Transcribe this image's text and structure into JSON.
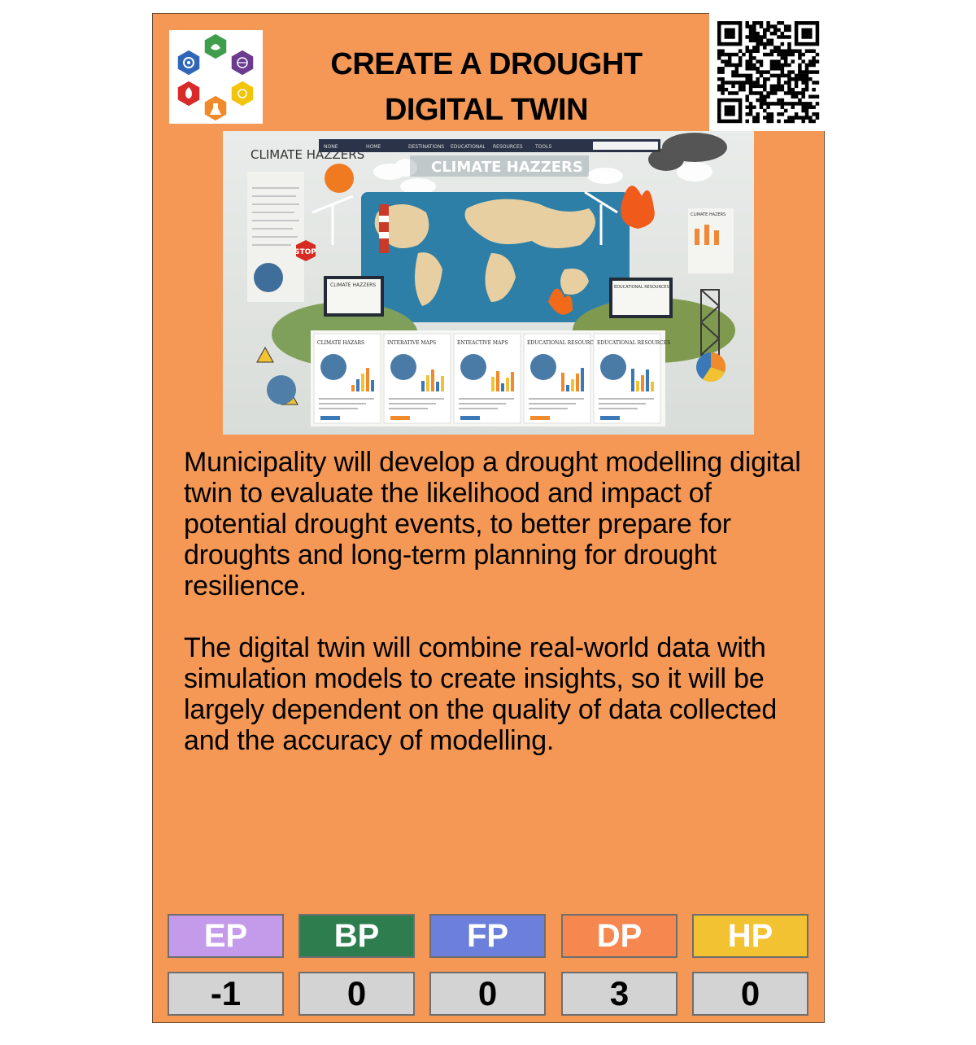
{
  "card": {
    "title_line1": "CREATE A DROUGHT",
    "title_line2": "DIGITAL TWIN",
    "paragraph1": "Municipality will develop a drought modelling digital twin to evaluate the likelihood and impact of potential drought events, to better prepare for droughts and long-term planning for drought resilience.",
    "paragraph2": "The digital twin will combine real-world data with simulation models to create insights, so it will be largely dependent on the quality of data collected and the accuracy of modelling."
  },
  "hero": {
    "left_title": "CLIMATE HAZZERS",
    "banner_title": "CLIMATE HAZZERS",
    "nav": [
      "NONE",
      "HOME",
      "DESTINATIONS",
      "EDUCATIONAL",
      "RESOURCES",
      "TOOLS"
    ],
    "stop_sign": "STOP",
    "monitor_left": "CLIMATE HAZZERS",
    "monitor_right": "EDUCATIONAL RESOURCES",
    "side_panel": "CLIMATE HAZERS",
    "panels": [
      "CLIMATE HAZARS",
      "INTERATIVE MAPS",
      "ENTEACTIVE MAPS",
      "EDUCATIONAL RESOURCES",
      "EDUCATIONAL RESOURCES"
    ]
  },
  "stats": [
    {
      "label": "EP",
      "value": "-1",
      "color": "#c49bea"
    },
    {
      "label": "BP",
      "value": "0",
      "color": "#2e7d4f"
    },
    {
      "label": "FP",
      "value": "0",
      "color": "#6b7fdb"
    },
    {
      "label": "DP",
      "value": "3",
      "color": "#f5874f"
    },
    {
      "label": "HP",
      "value": "0",
      "color": "#f2c232"
    }
  ],
  "icons": {
    "logo": "hexagon-logo-icon",
    "qr": "qr-code-icon"
  }
}
